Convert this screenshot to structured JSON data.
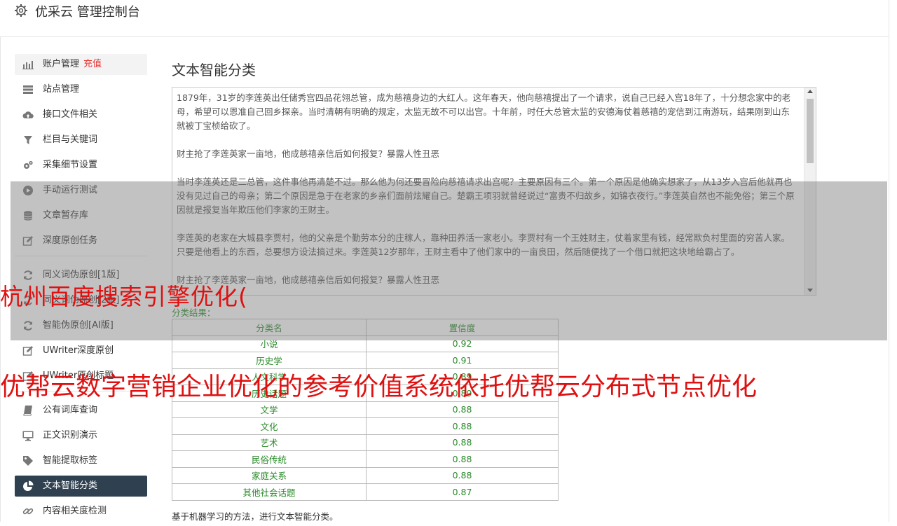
{
  "app": {
    "title": "优采云 管理控制台",
    "icon": "gear-icon"
  },
  "sidebar": {
    "groups": [
      [
        {
          "label": "账户管理",
          "badge": "充值",
          "icon": "bar-chart-icon"
        },
        {
          "label": "站点管理",
          "icon": "server-icon"
        },
        {
          "label": "接口文件相关",
          "icon": "cloud-upload-icon"
        },
        {
          "label": "栏目与关键词",
          "icon": "filter-icon"
        },
        {
          "label": "采集细节设置",
          "icon": "gears-icon"
        },
        {
          "label": "手动运行测试",
          "icon": "play-icon"
        },
        {
          "label": "文章暂存库",
          "icon": "database-icon"
        },
        {
          "label": "深度原创任务",
          "icon": "edit-icon"
        }
      ],
      [
        {
          "label": "同义词伪原创[1版]",
          "icon": "refresh-icon"
        },
        {
          "label": "同义词伪原创[2版]",
          "icon": "refresh-icon"
        },
        {
          "label": "智能伪原创[AI版]",
          "icon": "refresh-icon"
        },
        {
          "label": "UWriter深度原创",
          "icon": "edit-icon"
        },
        {
          "label": "UWriter原创标题",
          "icon": "edit-icon"
        }
      ],
      [
        {
          "label": "公有词库查询",
          "icon": "book-icon"
        },
        {
          "label": "正文识别演示",
          "icon": "desktop-icon"
        },
        {
          "label": "智能提取标签",
          "icon": "tag-icon"
        },
        {
          "label": "文本智能分类",
          "icon": "pie-chart-icon",
          "active": true
        },
        {
          "label": "内容相关度检测",
          "icon": "link-icon"
        }
      ]
    ]
  },
  "main": {
    "title": "文本智能分类",
    "paragraphs": [
      "1879年，31岁的李莲英出任储秀宫四品花翎总管，成为慈禧身边的大红人。这年春天，他向慈禧提出了一个请求，说自己已经入宫18年了，十分想念家中的老母，希望可以恩准自己回乡探亲。当时清朝有明确的规定，太监无故不可以出宫。十年前，时任大总管太监的安德海仗着慈禧的宠信到江南游玩，结果刚到山东就被丁宝桢给砍了。",
      "财主抢了李莲英家一亩地，他成慈禧亲信后如何报复？暴露人性丑恶",
      "当时李莲英还是二总管，这件事他再清楚不过。那么他为何还要冒险向慈禧请求出宫呢？主要原因有三个。第一个原因是他确实想家了，从13岁入宫后他就再也没有见过自己的母亲；第二个原因是急于在老家的乡亲们面前炫耀自己。楚霸王项羽就曾经说过“富贵不归故乡，如锦衣夜行。”李莲英自然也不能免俗；第三个原因就是报复当年欺压他们李家的王财主。",
      "李莲英的老家在大城县李贾村，他的父亲是个勤劳本分的庄稼人，靠种田养活一家老小。李贾村有一个王姓财主，仗着家里有钱，经常欺负村里面的穷苦人家。只要是他看上的东西，总要想方设法搞过来。李莲英12岁那年，王财主看中了他们家中的一亩良田，然后随便找了一个借口就把这块地给霸占了。",
      "财主抢了李莲英家一亩地，他成慈禧亲信后如何报复？暴露人性丑恶"
    ],
    "result_label": "分类结果：",
    "table": {
      "headers": [
        "分类名",
        "置信度"
      ],
      "rows": [
        [
          "小说",
          "0.92"
        ],
        [
          "历史学",
          "0.91"
        ],
        [
          "人文科学",
          "0.89"
        ],
        [
          "历史话题",
          "0.89"
        ],
        [
          "文学",
          "0.88"
        ],
        [
          "文化",
          "0.88"
        ],
        [
          "艺术",
          "0.88"
        ],
        [
          "民俗传统",
          "0.88"
        ],
        [
          "家庭关系",
          "0.88"
        ],
        [
          "其他社会话题",
          "0.87"
        ]
      ]
    },
    "footnote": "基于机器学习的方法，进行文本智能分类。"
  },
  "overlay": {
    "text1": "杭州百度搜索引擎优化(",
    "text2": "优帮云数字营销企业优化的参考价值系统依托优帮云分布式节点优化"
  },
  "colors": {
    "active_nav_bg": "#2f4050",
    "result_text": "#2a8a2a",
    "overlay_text": "#e01010",
    "recharge": "#e33"
  }
}
